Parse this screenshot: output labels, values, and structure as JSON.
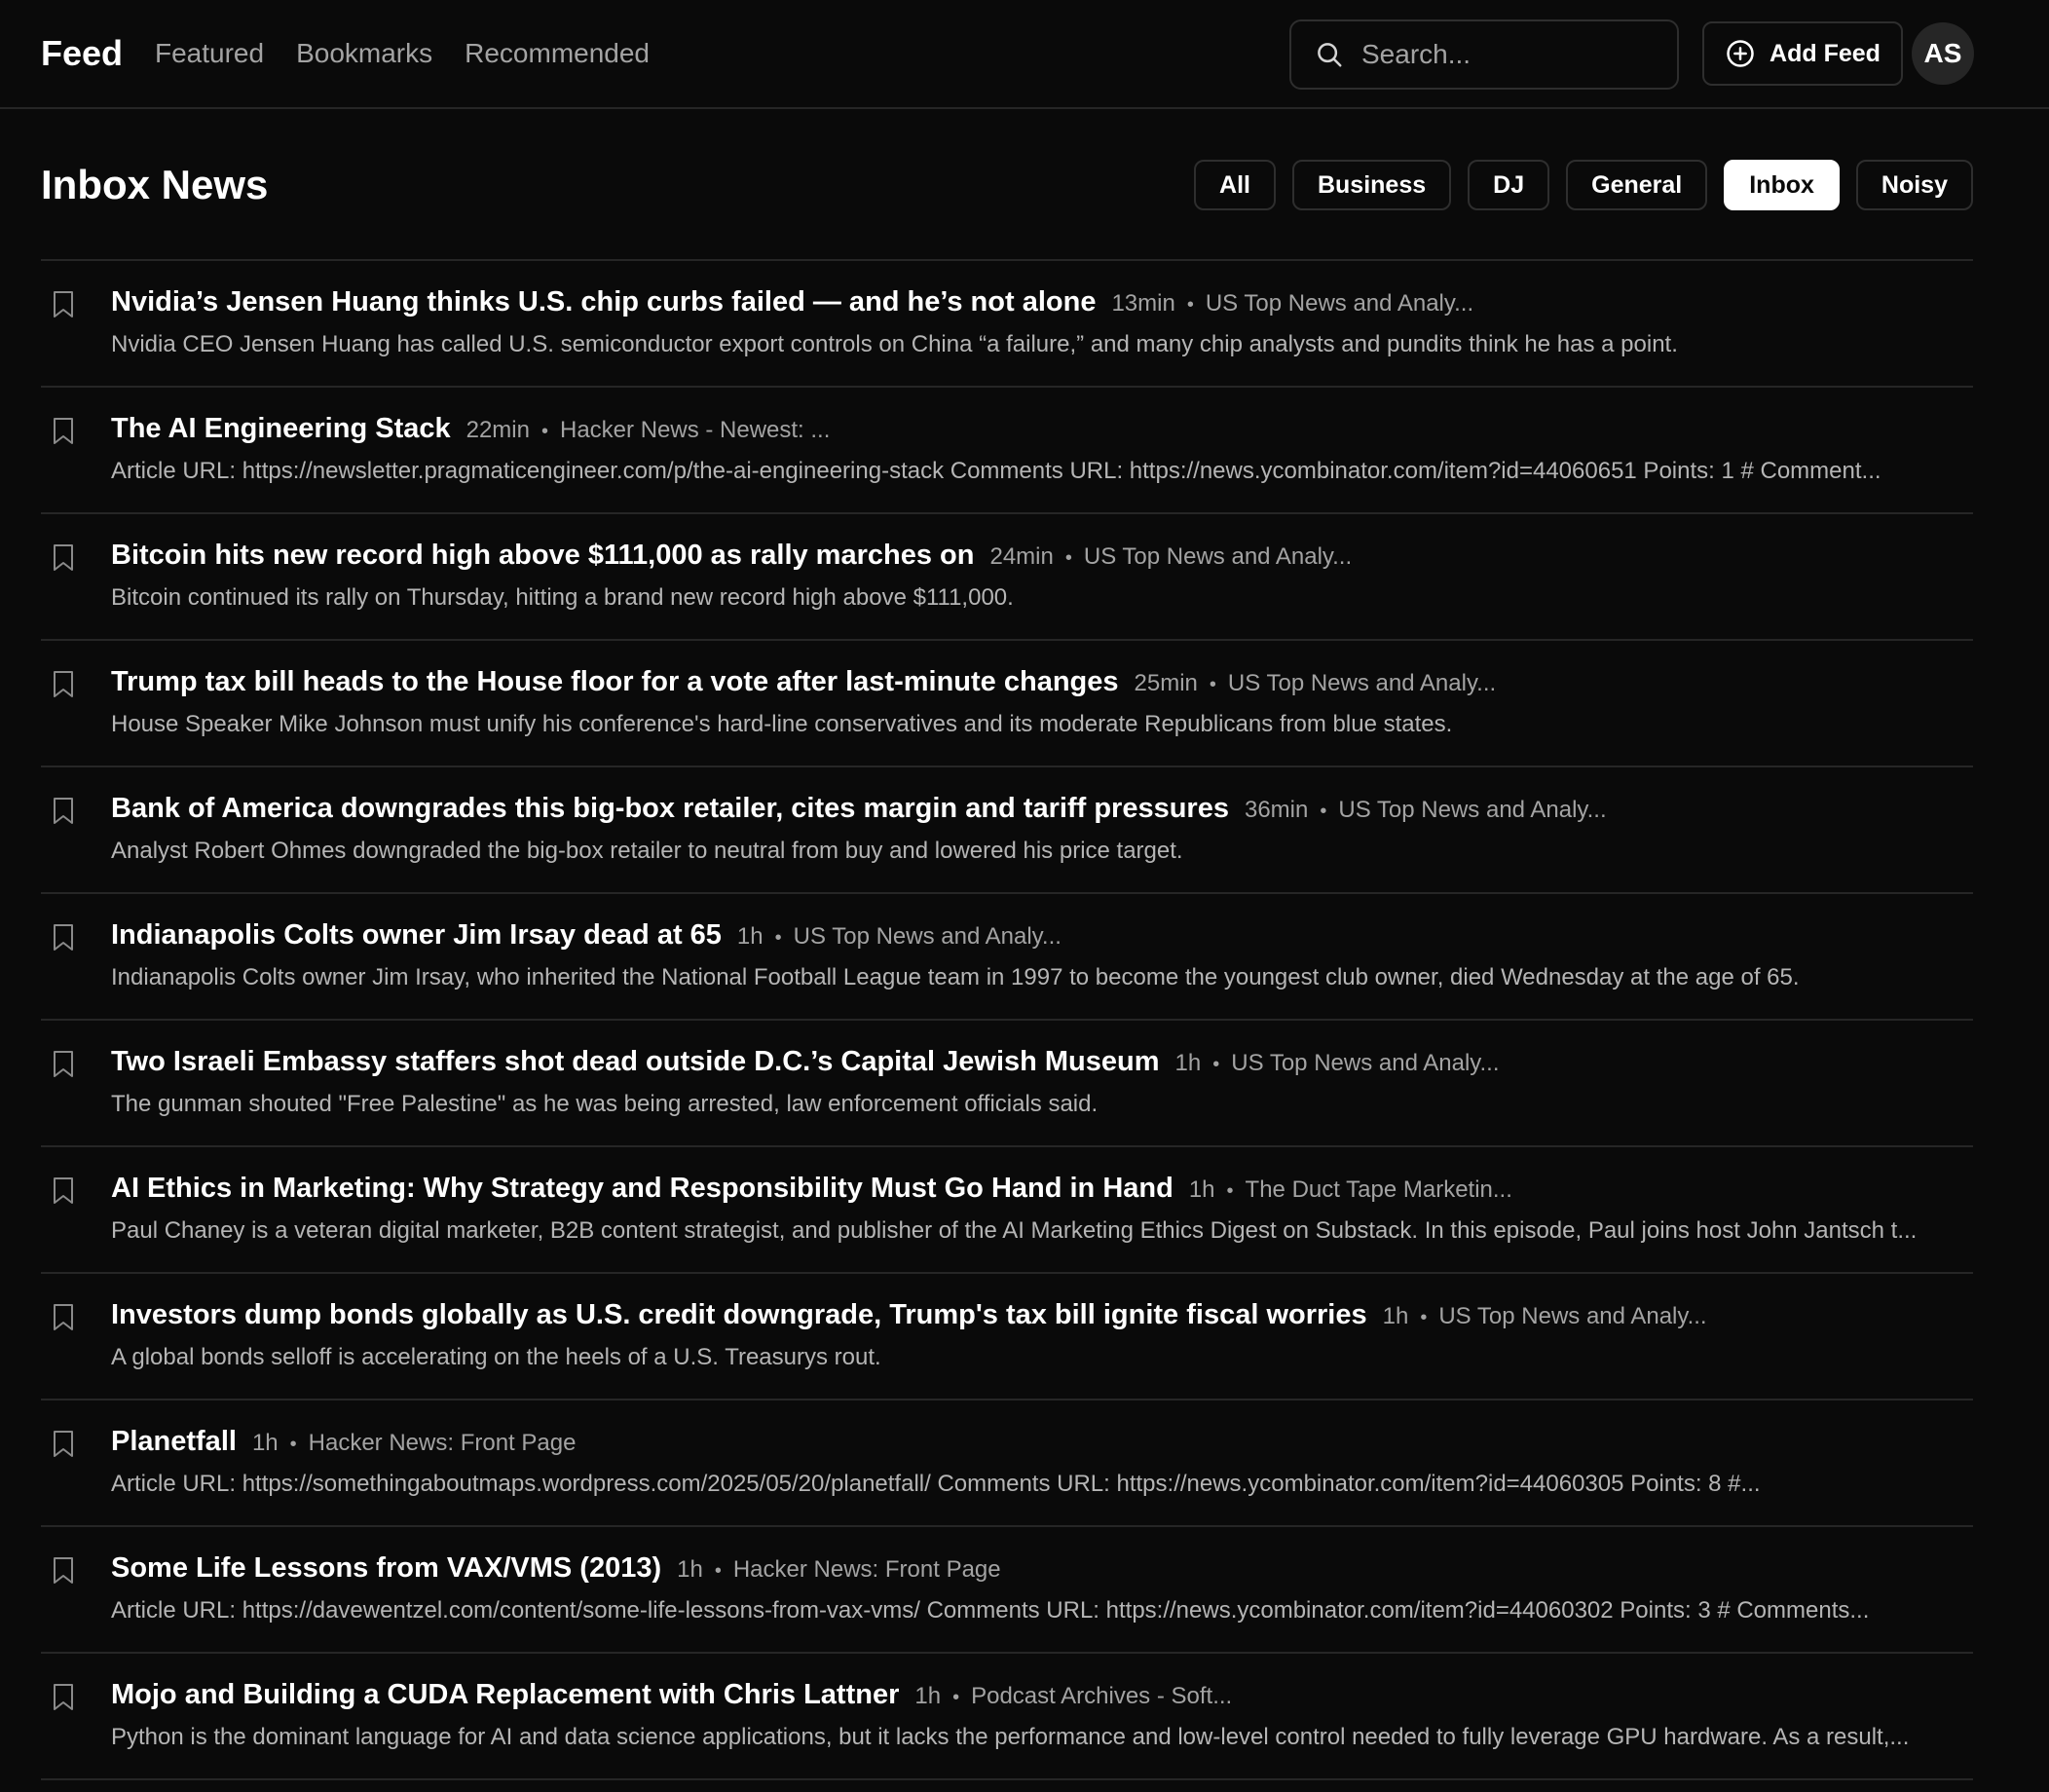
{
  "header": {
    "brand": "Feed",
    "nav": [
      "Featured",
      "Bookmarks",
      "Recommended"
    ],
    "search_placeholder": "Search...",
    "add_feed_label": "Add Feed",
    "avatar_initials": "AS"
  },
  "page": {
    "title": "Inbox News",
    "filters": [
      "All",
      "Business",
      "DJ",
      "General",
      "Inbox",
      "Noisy"
    ],
    "active_filter": "Inbox"
  },
  "items": [
    {
      "title": "Nvidia’s Jensen Huang thinks U.S. chip curbs failed — and he’s not alone",
      "time": "13min",
      "source": "US Top News and Analy...",
      "desc": "Nvidia CEO Jensen Huang has called U.S. semiconductor export controls on China “a failure,” and many chip analysts and pundits think he has a point."
    },
    {
      "title": "The AI Engineering Stack",
      "time": "22min",
      "source": "Hacker News - Newest: ...",
      "desc": "Article URL: https://newsletter.pragmaticengineer.com/p/the-ai-engineering-stack Comments URL: https://news.ycombinator.com/item?id=44060651 Points: 1 # Comment..."
    },
    {
      "title": "Bitcoin hits new record high above $111,000 as rally marches on",
      "time": "24min",
      "source": "US Top News and Analy...",
      "desc": "Bitcoin continued its rally on Thursday, hitting a brand new record high above $111,000."
    },
    {
      "title": "Trump tax bill heads to the House floor for a vote after last-minute changes",
      "time": "25min",
      "source": "US Top News and Analy...",
      "desc": "House Speaker Mike Johnson must unify his conference's hard-line conservatives and its moderate Republicans from blue states."
    },
    {
      "title": "Bank of America downgrades this big-box retailer, cites margin and tariff pressures",
      "time": "36min",
      "source": "US Top News and Analy...",
      "desc": "Analyst Robert Ohmes downgraded the big-box retailer to neutral from buy and lowered his price target."
    },
    {
      "title": "Indianapolis Colts owner Jim Irsay dead at 65",
      "time": "1h",
      "source": "US Top News and Analy...",
      "desc": "Indianapolis Colts owner Jim Irsay, who inherited the National Football League team in 1997 to become the youngest club owner, died Wednesday at the age of 65."
    },
    {
      "title": "Two Israeli Embassy staffers shot dead outside D.C.’s Capital Jewish Museum",
      "time": "1h",
      "source": "US Top News and Analy...",
      "desc": "The gunman shouted \"Free Palestine\" as he was being arrested, law enforcement officials said."
    },
    {
      "title": "AI Ethics in Marketing: Why Strategy and Responsibility Must Go Hand in Hand",
      "time": "1h",
      "source": "The Duct Tape Marketin...",
      "desc": "Paul Chaney is a veteran digital marketer, B2B content strategist, and publisher of the AI Marketing Ethics Digest on Substack. In this episode, Paul joins host John Jantsch t..."
    },
    {
      "title": "Investors dump bonds globally as U.S. credit downgrade, Trump's tax bill ignite fiscal worries",
      "time": "1h",
      "source": "US Top News and Analy...",
      "desc": "A global bonds selloff is accelerating on the heels of a U.S. Treasurys rout."
    },
    {
      "title": "Planetfall",
      "time": "1h",
      "source": "Hacker News: Front Page",
      "desc": "Article URL: https://somethingaboutmaps.wordpress.com/2025/05/20/planetfall/ Comments URL: https://news.ycombinator.com/item?id=44060305 Points: 8 #..."
    },
    {
      "title": "Some Life Lessons from VAX/VMS (2013)",
      "time": "1h",
      "source": "Hacker News: Front Page",
      "desc": "Article URL: https://davewentzel.com/content/some-life-lessons-from-vax-vms/ Comments URL: https://news.ycombinator.com/item?id=44060302 Points: 3 # Comments..."
    },
    {
      "title": "Mojo and Building a CUDA Replacement with Chris Lattner",
      "time": "1h",
      "source": "Podcast Archives - Soft...",
      "desc": "Python is the dominant language for AI and data science applications, but it lacks the performance and low-level control needed to fully leverage GPU hardware. As a result,..."
    }
  ]
}
